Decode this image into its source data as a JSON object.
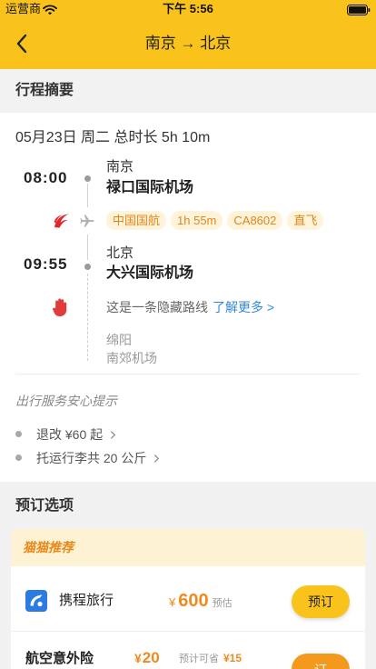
{
  "status_bar": {
    "carrier": "运营商",
    "time": "下午 5:56",
    "icons": [
      "wifi-icon",
      "battery-icon"
    ]
  },
  "nav": {
    "title": "南京 → 北京",
    "back_icon": "chevron-left-icon"
  },
  "summary": {
    "section_title": "行程摘要",
    "date_line": "05月23日 周二 总时长 5h 10m",
    "departure": {
      "time": "08:00",
      "city": "南京",
      "airport": "禄口国际机场"
    },
    "airline_icon": "air-china-logo",
    "flight_tags": [
      "中国国航",
      "1h 55m",
      "CA8602",
      "直飞"
    ],
    "arrival": {
      "time": "09:55",
      "city": "北京",
      "airport": "大兴国际机场"
    },
    "hidden_route": {
      "icon": "hand-stop-icon",
      "text": "这是一条隐藏路线",
      "link": "了解更多 >"
    },
    "hidden_stop": {
      "city": "绵阳",
      "airport": "南郊机场"
    },
    "tips_title": "出行服务安心提示",
    "tips": [
      {
        "label": "退改 ¥60 起"
      },
      {
        "label": "托运行李共 20 公斤"
      }
    ]
  },
  "booking": {
    "section_title": "预订选项",
    "recommend_label": "猫猫推荐",
    "options": [
      {
        "icon": "ctrip-logo",
        "name": "携程旅行",
        "currency": "¥",
        "price": "600",
        "price_note": "预估",
        "button": "预订"
      },
      {
        "name": "航空意外险",
        "currency": "¥",
        "price": "20",
        "save_label": "预计可省",
        "save_amount": "¥15",
        "button": "订"
      }
    ]
  },
  "colors": {
    "header": "#f9c31b",
    "tag_bg": "#fff3d9",
    "tag_text": "#e0861c",
    "price": "#f08a1e",
    "link": "#3388dd",
    "recommend_bg": "#fdf2d3",
    "orange_button": "#f39a1e",
    "page_bg": "#f1f1f1"
  }
}
